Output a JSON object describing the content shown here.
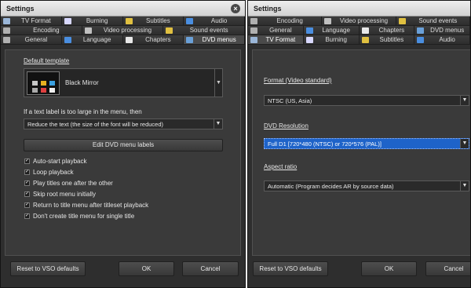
{
  "left": {
    "title": "Settings",
    "close_glyph": "×",
    "tabs_row1": [
      {
        "label": "TV Format",
        "icon": "monitor-icon",
        "color": "#9ab6d8"
      },
      {
        "label": "Burning",
        "icon": "disc-icon",
        "color": "#d8d8ff"
      },
      {
        "label": "Subtitles",
        "icon": "subtitle-icon",
        "color": "#e0c040"
      },
      {
        "label": "Audio",
        "icon": "music-note-icon",
        "color": "#4a8ee0"
      }
    ],
    "tabs_row2": [
      {
        "label": "Encoding",
        "icon": "gear-icon",
        "color": "#b0b0b0"
      },
      {
        "label": "Video processing",
        "icon": "film-icon",
        "color": "#c0c0c0"
      },
      {
        "label": "Sound events",
        "icon": "sound-icon",
        "color": "#e0c040"
      }
    ],
    "tabs_row3": [
      {
        "label": "General",
        "icon": "wrench-icon",
        "color": "#b0b0b0"
      },
      {
        "label": "Language",
        "icon": "globe-icon",
        "color": "#4a8ee0"
      },
      {
        "label": "Chapters",
        "icon": "clock-icon",
        "color": "#e8e8e8"
      },
      {
        "label": "DVD menus",
        "icon": "dvd-menu-icon",
        "color": "#6aa0d8",
        "active": true
      }
    ],
    "default_template_label": "Default template",
    "template_name": "Black Mirror",
    "label_too_large": "If a text label is too large in the menu, then",
    "label_option": "Reduce the text (the size of the font will be reduced)",
    "edit_button": "Edit DVD menu labels",
    "checkboxes": [
      {
        "label": "Auto-start playback",
        "checked": true
      },
      {
        "label": "Loop playback",
        "checked": true
      },
      {
        "label": "Play titles one after the other",
        "checked": true
      },
      {
        "label": "Skip root menu initially",
        "checked": true
      },
      {
        "label": "Return to title menu after titleset playback",
        "checked": true
      },
      {
        "label": "Don't create title menu for single title",
        "checked": true
      }
    ],
    "reset_button": "Reset to VSO defaults",
    "ok_button": "OK",
    "cancel_button": "Cancel"
  },
  "right": {
    "title": "Settings",
    "tabs_row1": [
      {
        "label": "Encoding",
        "icon": "gear-icon",
        "color": "#b0b0b0"
      },
      {
        "label": "Video processing",
        "icon": "film-icon",
        "color": "#c0c0c0"
      },
      {
        "label": "Sound events",
        "icon": "sound-icon",
        "color": "#e0c040"
      }
    ],
    "tabs_row2": [
      {
        "label": "General",
        "icon": "wrench-icon",
        "color": "#b0b0b0"
      },
      {
        "label": "Language",
        "icon": "globe-icon",
        "color": "#4a8ee0"
      },
      {
        "label": "Chapters",
        "icon": "clock-icon",
        "color": "#e8e8e8"
      },
      {
        "label": "DVD menus",
        "icon": "dvd-menu-icon",
        "color": "#6aa0d8"
      }
    ],
    "tabs_row3": [
      {
        "label": "TV Format",
        "icon": "monitor-icon",
        "color": "#9ab6d8",
        "active": true
      },
      {
        "label": "Burning",
        "icon": "disc-icon",
        "color": "#d8d8ff"
      },
      {
        "label": "Subtitles",
        "icon": "subtitle-icon",
        "color": "#e0c040"
      },
      {
        "label": "Audio",
        "icon": "music-note-icon",
        "color": "#4a8ee0"
      }
    ],
    "format_label": "Format (Video standard)",
    "format_value": "NTSC (US, Asia)",
    "resolution_label": "DVD Resolution",
    "resolution_value": "Full D1 [720*480 (NTSC) or 720*576 (PAL)]",
    "aspect_label": "Aspect ratio",
    "aspect_value": "Automatic (Program decides AR by source data)",
    "reset_button": "Reset to VSO defaults",
    "ok_button": "OK",
    "cancel_button": "Cancel"
  },
  "colors": {
    "window_bg": "#2e2e2e",
    "panel_bg": "#3a3a3a",
    "selection": "#1e63c9"
  }
}
